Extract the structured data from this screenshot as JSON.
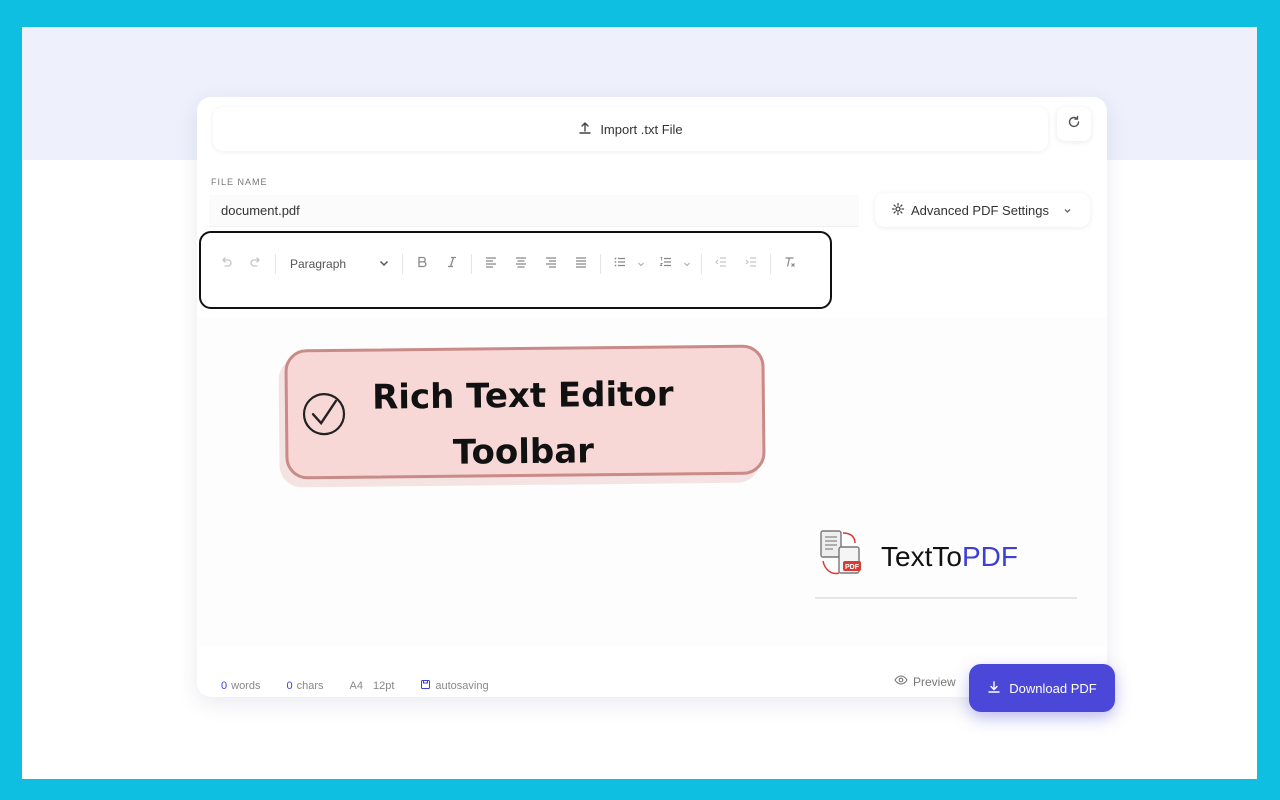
{
  "import": {
    "label": "Import .txt File"
  },
  "file": {
    "label": "FILE NAME",
    "value": "document.pdf"
  },
  "settings": {
    "label": "Advanced PDF Settings"
  },
  "toolbar": {
    "block_style": "Paragraph"
  },
  "annotation": {
    "line1": "Rich Text Editor",
    "line2": "Toolbar"
  },
  "brand": {
    "name_part1": "TextTo",
    "name_part2": "PDF",
    "icon_badge": "PDF"
  },
  "status": {
    "words_count": "0",
    "words_label": "words",
    "chars_count": "0",
    "chars_label": "chars",
    "page_size": "A4",
    "font_size": "12pt",
    "autosave": "autosaving"
  },
  "actions": {
    "preview_label": "Preview",
    "download_label": "Download PDF"
  },
  "colors": {
    "frame": "#0fbfe2",
    "accent": "#4b47d8",
    "annotation_fill": "#f7d8d6",
    "annotation_border": "#c98b88"
  }
}
